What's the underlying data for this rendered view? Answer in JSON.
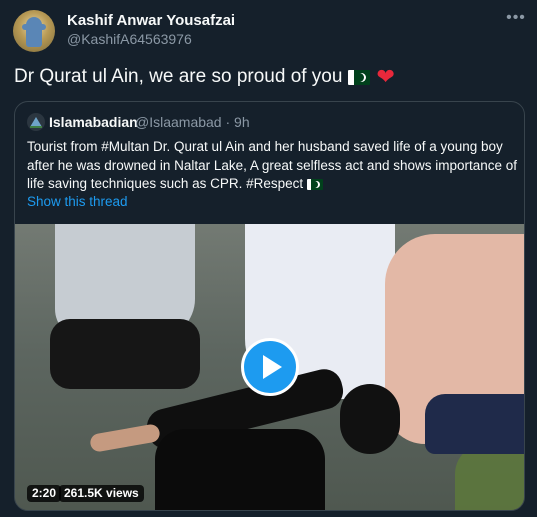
{
  "author": {
    "name": "Kashif Anwar Yousafzai",
    "handle": "@KashifA64563976"
  },
  "tweet": {
    "text": "Dr Qurat ul Ain, we are so proud of you"
  },
  "more_icon": "more-horizontal-icon",
  "quoted": {
    "name": "Islamabadian",
    "handle": "@Islaamabad · 9h",
    "text": "Tourist from #Multan Dr. Qurat ul Ain and her husband saved life of a young boy after he was drowned in Naltar Lake, A great selfless act and shows importance of life saving techniques such as CPR. #Respect",
    "show_thread": "Show this thread"
  },
  "video": {
    "duration": "2:20",
    "views": "261.5K views"
  },
  "colors": {
    "background": "#15202b",
    "accent": "#1d9bf0",
    "secondary_text": "#8b98a5",
    "heart": "#e8283b",
    "border": "#38444d"
  }
}
